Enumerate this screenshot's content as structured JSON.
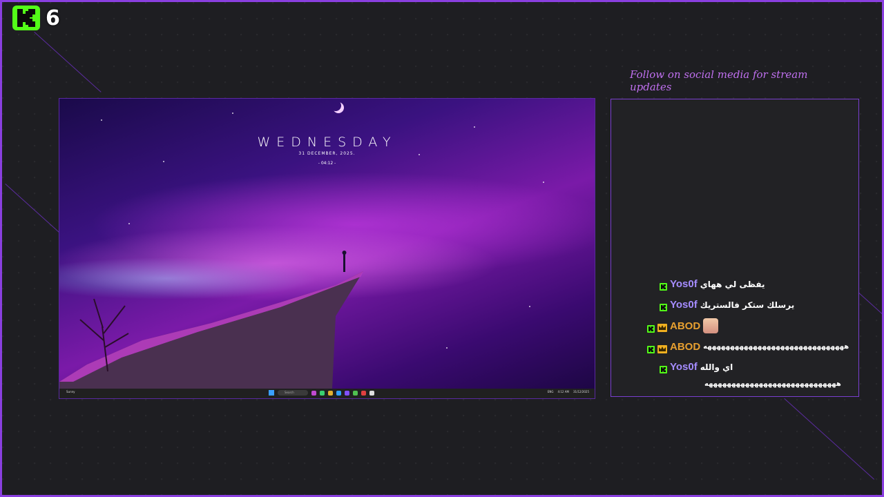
{
  "overlay": {
    "badge_number": "6",
    "follow_text": "Follow on social media for stream updates",
    "colors": {
      "accent": "#8a3fe0",
      "kick_green": "#53fc18",
      "follow": "#c070f0"
    }
  },
  "desktop": {
    "day": "WEDNESDAY",
    "date": "31 DECEMBER, 2025.",
    "time": "- 04:12 -",
    "taskbar": {
      "weather": "Sunny",
      "search_placeholder": "Search",
      "tray_lang": "ENG",
      "clock_time": "4:12 AM",
      "clock_date": "31/12/2025"
    }
  },
  "chat": {
    "messages": [
      {
        "user": "Yos0f",
        "text": "يفظى لي ههاي"
      },
      {
        "user": "Yos0f",
        "text": "يرسلك ستكر فالستريك"
      },
      {
        "user": "ABOD",
        "text": ""
      },
      {
        "user": "ABOD",
        "text": "هههههههههههههههههههههههههههههههه"
      },
      {
        "user": "Yos0f",
        "text": "اي والله"
      },
      {
        "user": "",
        "text": "هههههههههههههههههههههههههههههه"
      }
    ]
  }
}
